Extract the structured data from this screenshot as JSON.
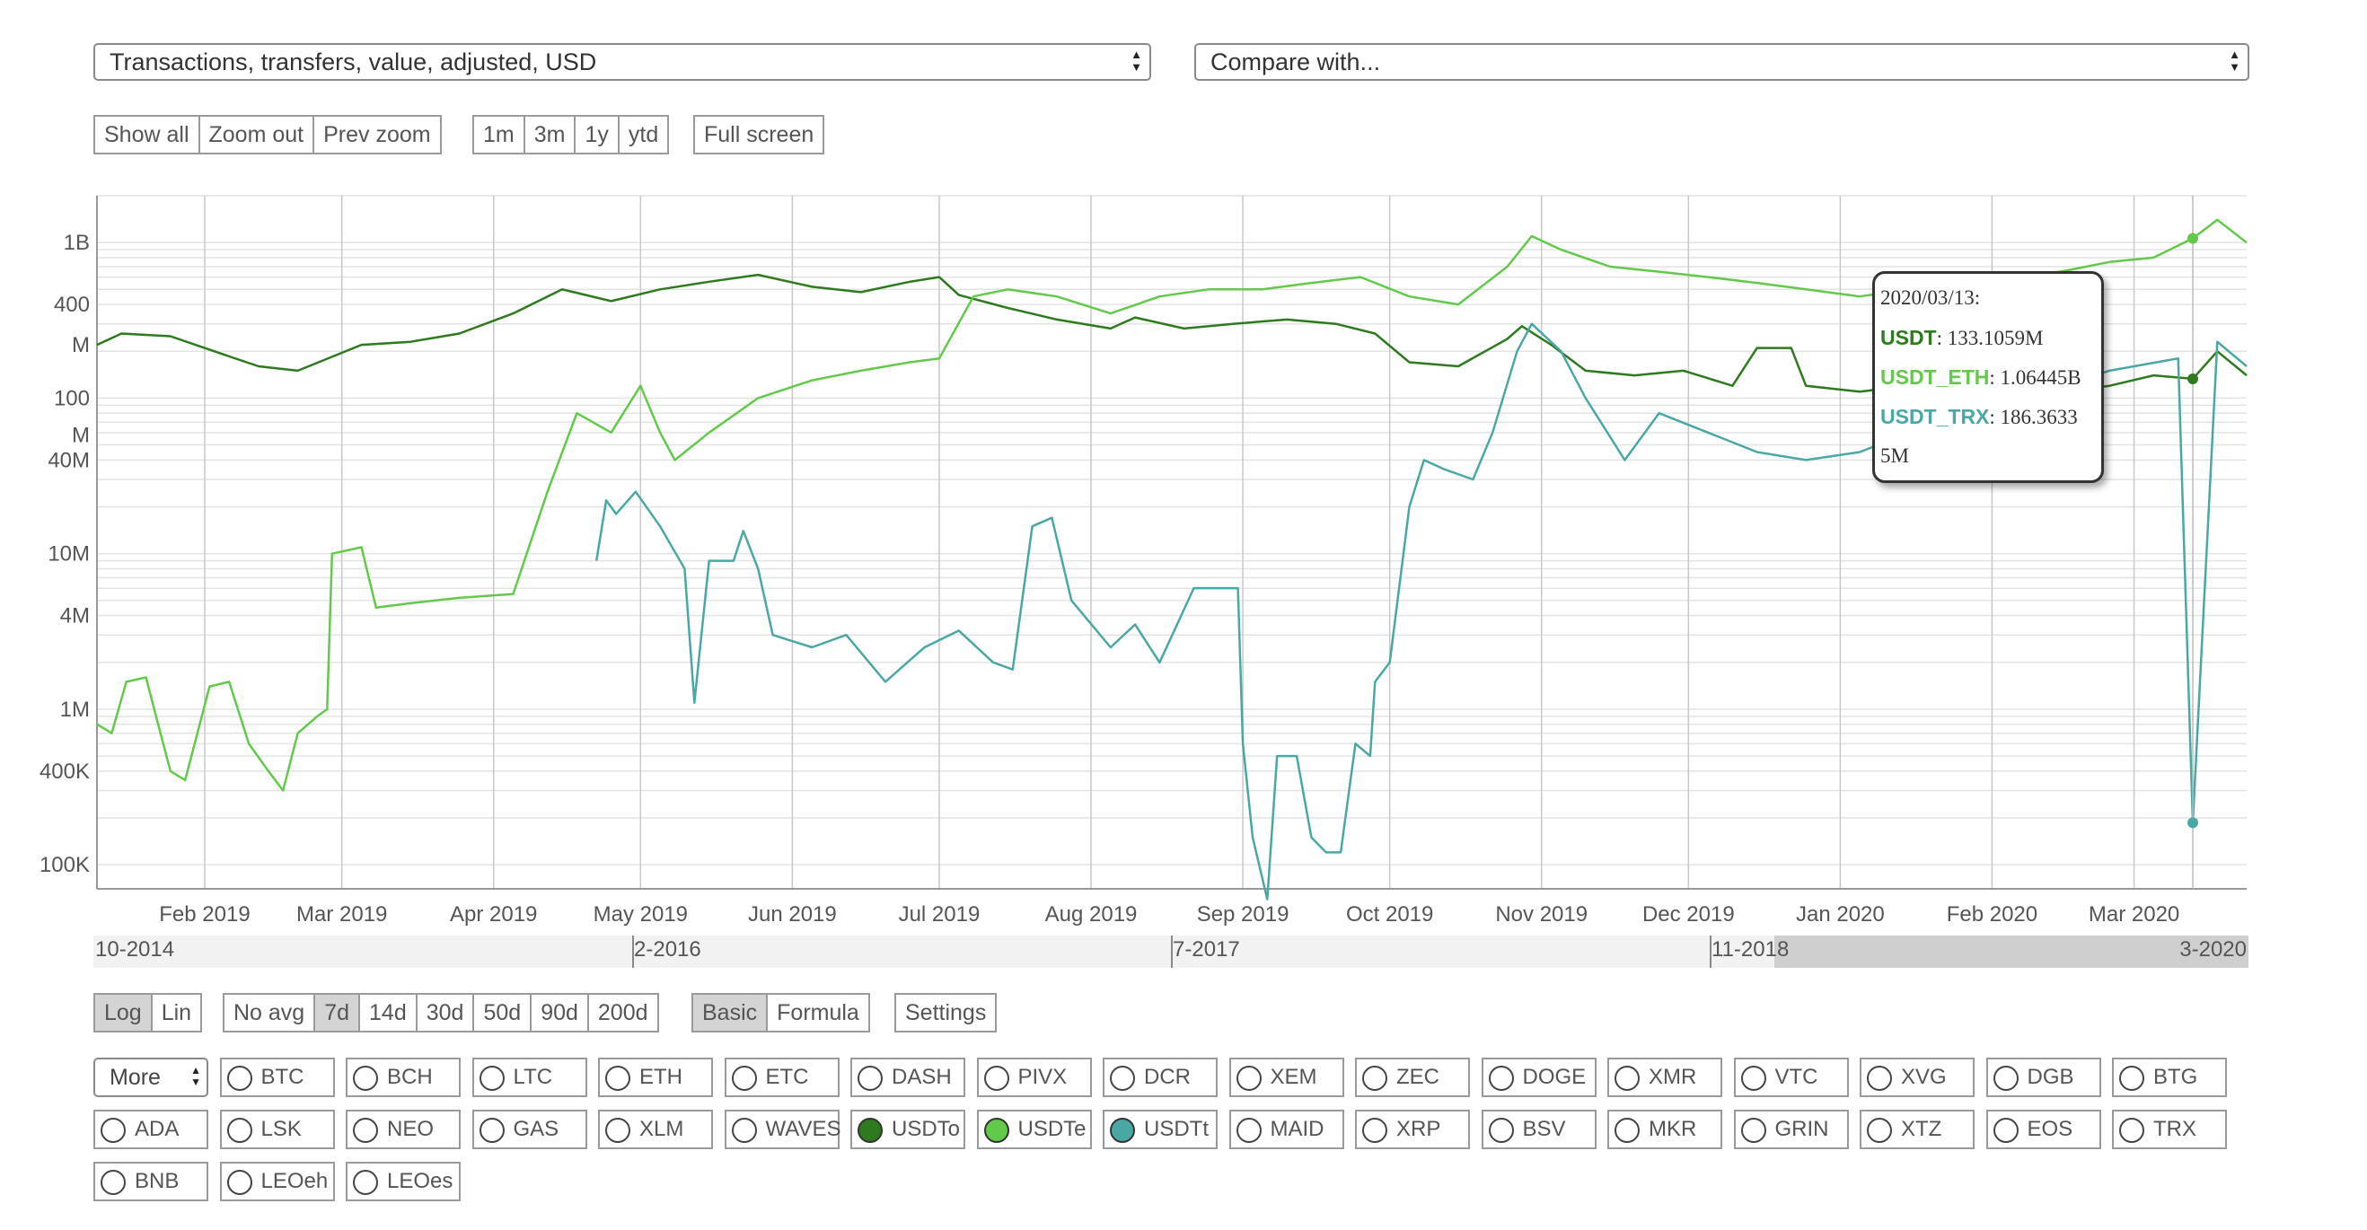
{
  "selectors": {
    "metric": "Transactions, transfers, value, adjusted, USD",
    "compare": "Compare with..."
  },
  "toolbar": {
    "show_all": "Show all",
    "zoom_out": "Zoom out",
    "prev_zoom": "Prev zoom",
    "ranges": [
      "1m",
      "3m",
      "1y",
      "ytd"
    ],
    "full_screen": "Full screen"
  },
  "navigator": {
    "labels": [
      "10-2014",
      "2-2016",
      "7-2017",
      "11-2018",
      "3-2020"
    ],
    "selected_from_fraction": 0.78,
    "selected_to_fraction": 1.0
  },
  "options": {
    "scale": [
      "Log",
      "Lin"
    ],
    "scale_active": "Log",
    "avg": [
      "No avg",
      "7d",
      "14d",
      "30d",
      "50d",
      "90d",
      "200d"
    ],
    "avg_active": "7d",
    "mode": [
      "Basic",
      "Formula"
    ],
    "mode_active": "Basic",
    "settings": "Settings"
  },
  "coins": {
    "more_label": "More",
    "items": [
      {
        "label": "BTC",
        "selected": false,
        "color": ""
      },
      {
        "label": "BCH",
        "selected": false,
        "color": ""
      },
      {
        "label": "LTC",
        "selected": false,
        "color": ""
      },
      {
        "label": "ETH",
        "selected": false,
        "color": ""
      },
      {
        "label": "ETC",
        "selected": false,
        "color": ""
      },
      {
        "label": "DASH",
        "selected": false,
        "color": ""
      },
      {
        "label": "PIVX",
        "selected": false,
        "color": ""
      },
      {
        "label": "DCR",
        "selected": false,
        "color": ""
      },
      {
        "label": "XEM",
        "selected": false,
        "color": ""
      },
      {
        "label": "ZEC",
        "selected": false,
        "color": ""
      },
      {
        "label": "DOGE",
        "selected": false,
        "color": ""
      },
      {
        "label": "XMR",
        "selected": false,
        "color": ""
      },
      {
        "label": "VTC",
        "selected": false,
        "color": ""
      },
      {
        "label": "XVG",
        "selected": false,
        "color": ""
      },
      {
        "label": "DGB",
        "selected": false,
        "color": ""
      },
      {
        "label": "BTG",
        "selected": false,
        "color": ""
      },
      {
        "label": "ADA",
        "selected": false,
        "color": ""
      },
      {
        "label": "LSK",
        "selected": false,
        "color": ""
      },
      {
        "label": "NEO",
        "selected": false,
        "color": ""
      },
      {
        "label": "GAS",
        "selected": false,
        "color": ""
      },
      {
        "label": "XLM",
        "selected": false,
        "color": ""
      },
      {
        "label": "WAVES",
        "selected": false,
        "color": ""
      },
      {
        "label": "USDTo",
        "selected": true,
        "color": "#2e7a1e"
      },
      {
        "label": "USDTe",
        "selected": true,
        "color": "#63c94a"
      },
      {
        "label": "USDTt",
        "selected": true,
        "color": "#4aa8a4"
      },
      {
        "label": "MAID",
        "selected": false,
        "color": ""
      },
      {
        "label": "XRP",
        "selected": false,
        "color": ""
      },
      {
        "label": "BSV",
        "selected": false,
        "color": ""
      },
      {
        "label": "MKR",
        "selected": false,
        "color": ""
      },
      {
        "label": "GRIN",
        "selected": false,
        "color": ""
      },
      {
        "label": "XTZ",
        "selected": false,
        "color": ""
      },
      {
        "label": "EOS",
        "selected": false,
        "color": ""
      },
      {
        "label": "TRX",
        "selected": false,
        "color": ""
      },
      {
        "label": "BNB",
        "selected": false,
        "color": ""
      },
      {
        "label": "LEOeh",
        "selected": false,
        "color": ""
      },
      {
        "label": "LEOes",
        "selected": false,
        "color": ""
      }
    ]
  },
  "tooltip": {
    "date": "2020/03/13:",
    "rows": [
      {
        "name": "USDT",
        "value": ": 133.1059M",
        "color": "#2e7a1e"
      },
      {
        "name": "USDT_ETH",
        "value": ": 1.06445B",
        "color": "#63c94a"
      },
      {
        "name": "USDT_TRX",
        "value": ": 186.3633",
        "color": "#4aa8a4"
      }
    ],
    "overflow": "5M"
  },
  "chart_data": {
    "type": "line",
    "scale": "log",
    "title": "",
    "x_range": [
      "2019-01-10",
      "2020-03-24"
    ],
    "ylim": [
      70000,
      2000000000
    ],
    "grid": true,
    "x_ticks": [
      "Feb 2019",
      "Mar 2019",
      "Apr 2019",
      "May 2019",
      "Jun 2019",
      "Jul 2019",
      "Aug 2019",
      "Sep 2019",
      "Oct 2019",
      "Nov 2019",
      "Dec 2019",
      "Jan 2020",
      "Feb 2020",
      "Mar 2020"
    ],
    "x_tick_dates": [
      "2019-02-01",
      "2019-03-01",
      "2019-04-01",
      "2019-05-01",
      "2019-06-01",
      "2019-07-01",
      "2019-08-01",
      "2019-09-01",
      "2019-10-01",
      "2019-11-01",
      "2019-12-01",
      "2020-01-01",
      "2020-02-01",
      "2020-03-01"
    ],
    "y_ticks": [
      {
        "label": "1B",
        "value": 1000000000
      },
      {
        "label": "400",
        "value": 400000000
      },
      {
        "label": "M",
        "value": 220000000
      },
      {
        "label": "100",
        "value": 100000000
      },
      {
        "label": "M",
        "value": 58000000
      },
      {
        "label": "40M",
        "value": 40000000
      },
      {
        "label": "10M",
        "value": 10000000
      },
      {
        "label": "4M",
        "value": 4000000
      },
      {
        "label": "1M",
        "value": 1000000
      },
      {
        "label": "400K",
        "value": 400000
      },
      {
        "label": "100K",
        "value": 100000
      }
    ],
    "series": [
      {
        "name": "USDT",
        "color": "#2e7a1e",
        "points": [
          [
            "2019-01-10",
            220000000
          ],
          [
            "2019-01-15",
            260000000
          ],
          [
            "2019-01-25",
            250000000
          ],
          [
            "2019-02-05",
            190000000
          ],
          [
            "2019-02-12",
            160000000
          ],
          [
            "2019-02-20",
            150000000
          ],
          [
            "2019-03-05",
            220000000
          ],
          [
            "2019-03-15",
            230000000
          ],
          [
            "2019-03-25",
            260000000
          ],
          [
            "2019-04-05",
            350000000
          ],
          [
            "2019-04-15",
            500000000
          ],
          [
            "2019-04-25",
            420000000
          ],
          [
            "2019-05-05",
            500000000
          ],
          [
            "2019-05-15",
            560000000
          ],
          [
            "2019-05-25",
            620000000
          ],
          [
            "2019-06-05",
            520000000
          ],
          [
            "2019-06-15",
            480000000
          ],
          [
            "2019-06-25",
            560000000
          ],
          [
            "2019-07-01",
            600000000
          ],
          [
            "2019-07-05",
            460000000
          ],
          [
            "2019-07-15",
            380000000
          ],
          [
            "2019-07-25",
            320000000
          ],
          [
            "2019-08-05",
            280000000
          ],
          [
            "2019-08-10",
            330000000
          ],
          [
            "2019-08-20",
            280000000
          ],
          [
            "2019-08-30",
            300000000
          ],
          [
            "2019-09-10",
            320000000
          ],
          [
            "2019-09-20",
            300000000
          ],
          [
            "2019-09-28",
            260000000
          ],
          [
            "2019-10-05",
            170000000
          ],
          [
            "2019-10-15",
            160000000
          ],
          [
            "2019-10-25",
            240000000
          ],
          [
            "2019-10-28",
            290000000
          ],
          [
            "2019-11-03",
            220000000
          ],
          [
            "2019-11-10",
            150000000
          ],
          [
            "2019-11-20",
            140000000
          ],
          [
            "2019-11-30",
            150000000
          ],
          [
            "2019-12-10",
            120000000
          ],
          [
            "2019-12-15",
            210000000
          ],
          [
            "2019-12-22",
            210000000
          ],
          [
            "2019-12-25",
            120000000
          ],
          [
            "2020-01-05",
            110000000
          ],
          [
            "2020-01-15",
            120000000
          ],
          [
            "2020-01-25",
            110000000
          ],
          [
            "2020-02-05",
            100000000
          ],
          [
            "2020-02-15",
            110000000
          ],
          [
            "2020-02-25",
            120000000
          ],
          [
            "2020-03-05",
            140000000
          ],
          [
            "2020-03-13",
            133000000
          ],
          [
            "2020-03-18",
            200000000
          ],
          [
            "2020-03-24",
            140000000
          ]
        ]
      },
      {
        "name": "USDT_ETH",
        "color": "#63c94a",
        "points": [
          [
            "2019-01-10",
            800000
          ],
          [
            "2019-01-13",
            700000
          ],
          [
            "2019-01-16",
            1500000
          ],
          [
            "2019-01-20",
            1600000
          ],
          [
            "2019-01-25",
            400000
          ],
          [
            "2019-01-28",
            350000
          ],
          [
            "2019-02-02",
            1400000
          ],
          [
            "2019-02-06",
            1500000
          ],
          [
            "2019-02-10",
            600000
          ],
          [
            "2019-02-14",
            400000
          ],
          [
            "2019-02-17",
            300000
          ],
          [
            "2019-02-20",
            700000
          ],
          [
            "2019-02-24",
            900000
          ],
          [
            "2019-02-26",
            1000000
          ],
          [
            "2019-02-27",
            10000000
          ],
          [
            "2019-03-05",
            11000000
          ],
          [
            "2019-03-08",
            4500000
          ],
          [
            "2019-03-15",
            4800000
          ],
          [
            "2019-03-25",
            5200000
          ],
          [
            "2019-04-05",
            5500000
          ],
          [
            "2019-04-12",
            25000000
          ],
          [
            "2019-04-18",
            80000000
          ],
          [
            "2019-04-25",
            60000000
          ],
          [
            "2019-05-01",
            120000000
          ],
          [
            "2019-05-05",
            60000000
          ],
          [
            "2019-05-08",
            40000000
          ],
          [
            "2019-05-15",
            60000000
          ],
          [
            "2019-05-25",
            100000000
          ],
          [
            "2019-06-05",
            130000000
          ],
          [
            "2019-06-15",
            150000000
          ],
          [
            "2019-06-25",
            170000000
          ],
          [
            "2019-07-01",
            180000000
          ],
          [
            "2019-07-08",
            450000000
          ],
          [
            "2019-07-15",
            500000000
          ],
          [
            "2019-07-25",
            450000000
          ],
          [
            "2019-08-05",
            350000000
          ],
          [
            "2019-08-15",
            450000000
          ],
          [
            "2019-08-25",
            500000000
          ],
          [
            "2019-09-05",
            500000000
          ],
          [
            "2019-09-15",
            550000000
          ],
          [
            "2019-09-25",
            600000000
          ],
          [
            "2019-10-05",
            450000000
          ],
          [
            "2019-10-15",
            400000000
          ],
          [
            "2019-10-25",
            700000000
          ],
          [
            "2019-10-30",
            1100000000
          ],
          [
            "2019-11-05",
            900000000
          ],
          [
            "2019-11-15",
            700000000
          ],
          [
            "2019-11-25",
            650000000
          ],
          [
            "2019-12-05",
            600000000
          ],
          [
            "2019-12-15",
            550000000
          ],
          [
            "2019-12-25",
            500000000
          ],
          [
            "2020-01-05",
            450000000
          ],
          [
            "2020-01-15",
            500000000
          ],
          [
            "2020-01-25",
            550000000
          ],
          [
            "2020-02-05",
            600000000
          ],
          [
            "2020-02-15",
            650000000
          ],
          [
            "2020-02-25",
            750000000
          ],
          [
            "2020-03-05",
            800000000
          ],
          [
            "2020-03-13",
            1064450000
          ],
          [
            "2020-03-18",
            1400000000
          ],
          [
            "2020-03-24",
            1000000000
          ]
        ]
      },
      {
        "name": "USDT_TRX",
        "color": "#4aa8a4",
        "points": [
          [
            "2019-04-22",
            9000000
          ],
          [
            "2019-04-24",
            22000000
          ],
          [
            "2019-04-26",
            18000000
          ],
          [
            "2019-04-30",
            25000000
          ],
          [
            "2019-05-05",
            15000000
          ],
          [
            "2019-05-10",
            8000000
          ],
          [
            "2019-05-12",
            1100000
          ],
          [
            "2019-05-15",
            9000000
          ],
          [
            "2019-05-20",
            9000000
          ],
          [
            "2019-05-22",
            14000000
          ],
          [
            "2019-05-25",
            8000000
          ],
          [
            "2019-05-28",
            3000000
          ],
          [
            "2019-06-05",
            2500000
          ],
          [
            "2019-06-12",
            3000000
          ],
          [
            "2019-06-20",
            1500000
          ],
          [
            "2019-06-28",
            2500000
          ],
          [
            "2019-07-05",
            3200000
          ],
          [
            "2019-07-12",
            2000000
          ],
          [
            "2019-07-16",
            1800000
          ],
          [
            "2019-07-20",
            15000000
          ],
          [
            "2019-07-24",
            17000000
          ],
          [
            "2019-07-28",
            5000000
          ],
          [
            "2019-08-05",
            2500000
          ],
          [
            "2019-08-10",
            3500000
          ],
          [
            "2019-08-15",
            2000000
          ],
          [
            "2019-08-22",
            6000000
          ],
          [
            "2019-08-31",
            6000000
          ],
          [
            "2019-09-01",
            600000
          ],
          [
            "2019-09-03",
            150000
          ],
          [
            "2019-09-06",
            60000
          ],
          [
            "2019-09-08",
            500000
          ],
          [
            "2019-09-12",
            500000
          ],
          [
            "2019-09-15",
            150000
          ],
          [
            "2019-09-18",
            120000
          ],
          [
            "2019-09-21",
            120000
          ],
          [
            "2019-09-24",
            600000
          ],
          [
            "2019-09-27",
            500000
          ],
          [
            "2019-09-28",
            1500000
          ],
          [
            "2019-10-01",
            2000000
          ],
          [
            "2019-10-05",
            20000000
          ],
          [
            "2019-10-08",
            40000000
          ],
          [
            "2019-10-12",
            35000000
          ],
          [
            "2019-10-18",
            30000000
          ],
          [
            "2019-10-22",
            60000000
          ],
          [
            "2019-10-27",
            200000000
          ],
          [
            "2019-10-30",
            300000000
          ],
          [
            "2019-11-05",
            200000000
          ],
          [
            "2019-11-10",
            100000000
          ],
          [
            "2019-11-18",
            40000000
          ],
          [
            "2019-11-25",
            80000000
          ],
          [
            "2019-12-05",
            60000000
          ],
          [
            "2019-12-15",
            45000000
          ],
          [
            "2019-12-25",
            40000000
          ],
          [
            "2020-01-05",
            45000000
          ],
          [
            "2020-01-15",
            60000000
          ],
          [
            "2020-01-25",
            80000000
          ],
          [
            "2020-02-05",
            100000000
          ],
          [
            "2020-02-15",
            120000000
          ],
          [
            "2020-02-25",
            150000000
          ],
          [
            "2020-03-10",
            180000000
          ],
          [
            "2020-03-13",
            186363
          ],
          [
            "2020-03-18",
            230000000
          ],
          [
            "2020-03-24",
            160000000
          ]
        ]
      }
    ],
    "highlight_date": "2020-03-13"
  }
}
